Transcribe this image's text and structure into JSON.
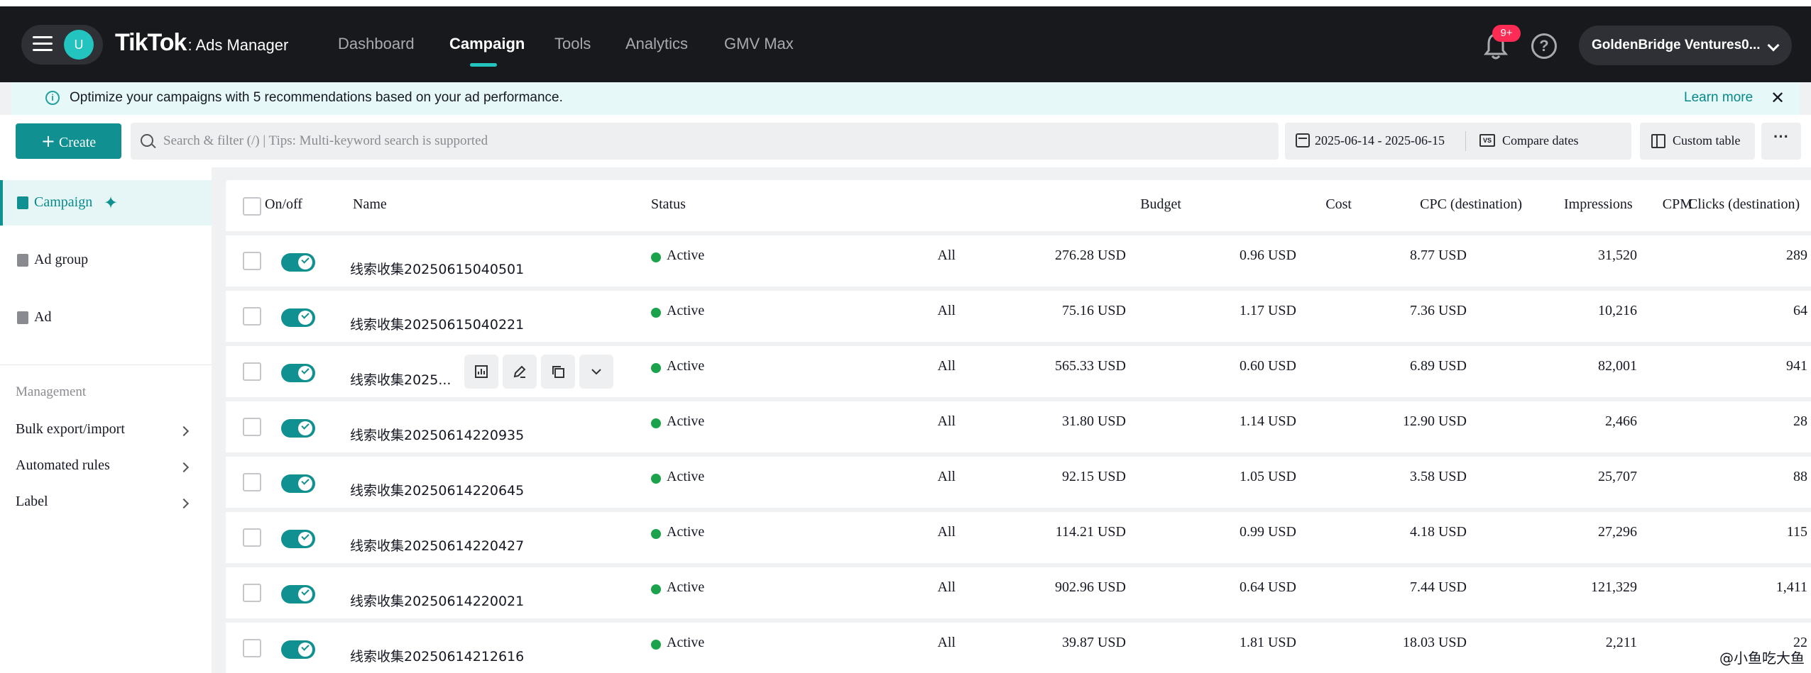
{
  "header": {
    "avatar_letter": "U",
    "logo_main": "TikTok",
    "logo_sub": ": Ads Manager",
    "nav": [
      {
        "label": "Dashboard",
        "active": false
      },
      {
        "label": "Campaign",
        "active": true
      },
      {
        "label": "Tools",
        "active": false
      },
      {
        "label": "Analytics",
        "active": false
      },
      {
        "label": "GMV Max",
        "active": false
      }
    ],
    "notification_badge": "9+",
    "account_name": "GoldenBridge Ventures0...",
    "accent_color": "#23c4c0"
  },
  "banner": {
    "text": "Optimize your campaigns with 5 recommendations based on your ad performance.",
    "learn_more": "Learn more",
    "close": "✕"
  },
  "toolbar": {
    "create_label": "Create",
    "search_placeholder": "Search & filter (/) | Tips: Multi-keyword search is supported",
    "date_range": "2025-06-14 - 2025-06-15",
    "compare_label": "Compare dates",
    "custom_table_label": "Custom table",
    "more_label": "···"
  },
  "sidebar": {
    "items": [
      {
        "label": "Campaign",
        "active": true
      },
      {
        "label": "Ad group",
        "active": false
      },
      {
        "label": "Ad",
        "active": false
      }
    ],
    "management_title": "Management",
    "management_items": [
      {
        "label": "Bulk export/import"
      },
      {
        "label": "Automated rules"
      },
      {
        "label": "Label"
      }
    ]
  },
  "table": {
    "columns": {
      "onoff": "On/off",
      "name": "Name",
      "status": "Status",
      "budget": "Budget",
      "cost": "Cost",
      "cpc": "CPC (destination)",
      "cpm": "CPM",
      "impressions": "Impressions",
      "clicks": "Clicks (destination)"
    },
    "rows": [
      {
        "name": "线索收集20250615040501",
        "status": "Active",
        "budget": "All",
        "cost": "276.28 USD",
        "cpc": "0.96 USD",
        "cpm": "8.77 USD",
        "impressions": "31,520",
        "clicks": "289"
      },
      {
        "name": "线索收集20250615040221",
        "status": "Active",
        "budget": "All",
        "cost": "75.16 USD",
        "cpc": "1.17 USD",
        "cpm": "7.36 USD",
        "impressions": "10,216",
        "clicks": "64"
      },
      {
        "name": "线索收集2025...",
        "status": "Active",
        "budget": "All",
        "cost": "565.33 USD",
        "cpc": "0.60 USD",
        "cpm": "6.89 USD",
        "impressions": "82,001",
        "clicks": "941",
        "hovered": true
      },
      {
        "name": "线索收集20250614220935",
        "status": "Active",
        "budget": "All",
        "cost": "31.80 USD",
        "cpc": "1.14 USD",
        "cpm": "12.90 USD",
        "impressions": "2,466",
        "clicks": "28"
      },
      {
        "name": "线索收集20250614220645",
        "status": "Active",
        "budget": "All",
        "cost": "92.15 USD",
        "cpc": "1.05 USD",
        "cpm": "3.58 USD",
        "impressions": "25,707",
        "clicks": "88"
      },
      {
        "name": "线索收集20250614220427",
        "status": "Active",
        "budget": "All",
        "cost": "114.21 USD",
        "cpc": "0.99 USD",
        "cpm": "4.18 USD",
        "impressions": "27,296",
        "clicks": "115"
      },
      {
        "name": "线索收集20250614220021",
        "status": "Active",
        "budget": "All",
        "cost": "902.96 USD",
        "cpc": "0.64 USD",
        "cpm": "7.44 USD",
        "impressions": "121,329",
        "clicks": "1,411"
      },
      {
        "name": "线索收集20250614212616",
        "status": "Active",
        "budget": "All",
        "cost": "39.87 USD",
        "cpc": "1.81 USD",
        "cpm": "18.03 USD",
        "impressions": "2,211",
        "clicks": "22"
      }
    ],
    "row_action_icons": [
      "chart-icon",
      "edit-icon",
      "copy-icon",
      "chevron-down-icon"
    ],
    "status_color": "#1aa34a",
    "toggle_color": "#109090"
  },
  "watermark": "@小鱼吃大鱼"
}
